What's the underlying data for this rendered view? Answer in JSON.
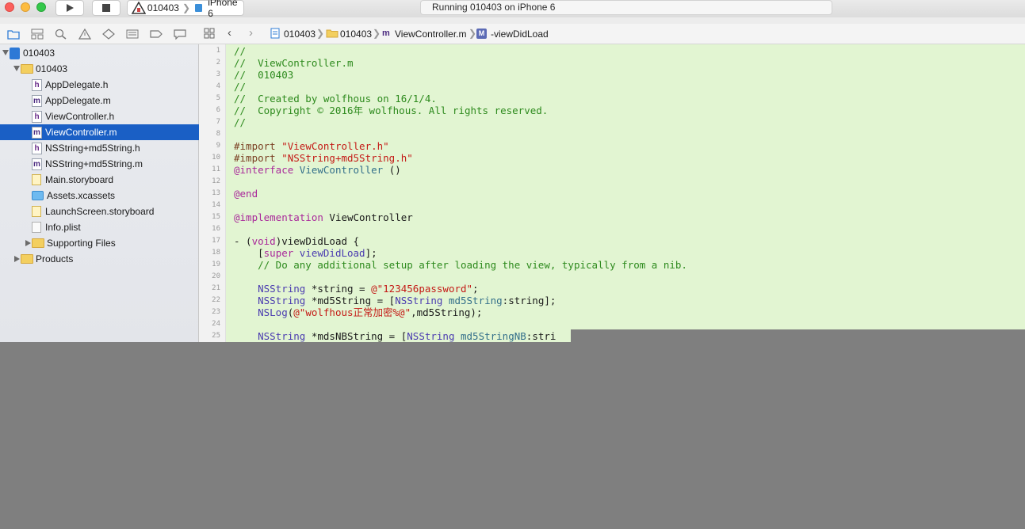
{
  "toolbar": {
    "scheme_name": "010403",
    "device_name": "iPhone 6",
    "activity_text": "Running 010403 on iPhone 6"
  },
  "navigator": {
    "icons": [
      "folder-icon",
      "hierarchy-icon",
      "search-icon",
      "warning-icon",
      "test-icon",
      "debug-icon",
      "breakpoint-icon",
      "report-icon"
    ],
    "tree": [
      {
        "label": "010403",
        "kind": "project",
        "indent": 0,
        "disclosure": "down"
      },
      {
        "label": "010403",
        "kind": "folder",
        "indent": 1,
        "disclosure": "down"
      },
      {
        "label": "AppDelegate.h",
        "kind": "h",
        "indent": 2
      },
      {
        "label": "AppDelegate.m",
        "kind": "m",
        "indent": 2
      },
      {
        "label": "ViewController.h",
        "kind": "h",
        "indent": 2
      },
      {
        "label": "ViewController.m",
        "kind": "m",
        "indent": 2,
        "selected": true
      },
      {
        "label": "NSString+md5String.h",
        "kind": "h",
        "indent": 2
      },
      {
        "label": "NSString+md5String.m",
        "kind": "m",
        "indent": 2
      },
      {
        "label": "Main.storyboard",
        "kind": "storyboard",
        "indent": 2
      },
      {
        "label": "Assets.xcassets",
        "kind": "assets",
        "indent": 2
      },
      {
        "label": "LaunchScreen.storyboard",
        "kind": "storyboard",
        "indent": 2
      },
      {
        "label": "Info.plist",
        "kind": "plist",
        "indent": 2
      },
      {
        "label": "Supporting Files",
        "kind": "folder",
        "indent": 2,
        "disclosure": "right"
      },
      {
        "label": "Products",
        "kind": "folder",
        "indent": 1,
        "disclosure": "right"
      }
    ]
  },
  "jumpbar": {
    "project": "010403",
    "group": "010403",
    "file": "ViewController.m",
    "method": "-viewDidLoad"
  },
  "editor": {
    "lines": [
      {
        "n": "1",
        "parts": [
          [
            "c-comment",
            "//"
          ]
        ]
      },
      {
        "n": "2",
        "parts": [
          [
            "c-comment",
            "//  ViewController.m"
          ]
        ]
      },
      {
        "n": "3",
        "parts": [
          [
            "c-comment",
            "//  010403"
          ]
        ]
      },
      {
        "n": "4",
        "parts": [
          [
            "c-comment",
            "//"
          ]
        ]
      },
      {
        "n": "5",
        "parts": [
          [
            "c-comment",
            "//  Created by wolfhous on 16/1/4."
          ]
        ]
      },
      {
        "n": "6",
        "parts": [
          [
            "c-comment",
            "//  Copyright © 2016年 wolfhous. All rights reserved."
          ]
        ]
      },
      {
        "n": "7",
        "parts": [
          [
            "c-comment",
            "//"
          ]
        ]
      },
      {
        "n": "8",
        "parts": []
      },
      {
        "n": "9",
        "parts": [
          [
            "c-pre",
            "#import "
          ],
          [
            "c-str",
            "\"ViewController.h\""
          ]
        ]
      },
      {
        "n": "10",
        "parts": [
          [
            "c-pre",
            "#import "
          ],
          [
            "c-str",
            "\"NSString+md5String.h\""
          ]
        ]
      },
      {
        "n": "11",
        "parts": [
          [
            "c-kw",
            "@interface "
          ],
          [
            "c-teal",
            "ViewController "
          ],
          [
            "c-plain",
            "()"
          ]
        ]
      },
      {
        "n": "12",
        "parts": []
      },
      {
        "n": "13",
        "parts": [
          [
            "c-kw",
            "@end"
          ]
        ]
      },
      {
        "n": "14",
        "parts": []
      },
      {
        "n": "15",
        "parts": [
          [
            "c-kw",
            "@implementation "
          ],
          [
            "c-plain",
            "ViewController"
          ]
        ]
      },
      {
        "n": "16",
        "parts": []
      },
      {
        "n": "17",
        "parts": [
          [
            "c-plain",
            "- ("
          ],
          [
            "c-kw",
            "void"
          ],
          [
            "c-plain",
            ")viewDidLoad {"
          ]
        ]
      },
      {
        "n": "18",
        "parts": [
          [
            "c-plain",
            "    ["
          ],
          [
            "c-kw",
            "super "
          ],
          [
            "c-cls",
            "viewDidLoad"
          ],
          [
            "c-plain",
            "];"
          ]
        ]
      },
      {
        "n": "19",
        "parts": [
          [
            "c-comment",
            "    // Do any additional setup after loading the view, typically from a nib."
          ]
        ]
      },
      {
        "n": "20",
        "parts": []
      },
      {
        "n": "21",
        "parts": [
          [
            "c-cls",
            "    NSString "
          ],
          [
            "c-plain",
            "*string = "
          ],
          [
            "c-str",
            "@\"123456password\""
          ],
          [
            "c-plain",
            ";"
          ]
        ]
      },
      {
        "n": "22",
        "parts": [
          [
            "c-cls",
            "    NSString "
          ],
          [
            "c-plain",
            "*md5String = ["
          ],
          [
            "c-cls",
            "NSString "
          ],
          [
            "c-teal",
            "md5String"
          ],
          [
            "c-plain",
            ":string];"
          ]
        ]
      },
      {
        "n": "23",
        "parts": [
          [
            "c-cls",
            "    NSLog"
          ],
          [
            "c-plain",
            "("
          ],
          [
            "c-str",
            "@\"wolfhous正常加密%@\""
          ],
          [
            "c-plain",
            ",md5String);"
          ]
        ]
      },
      {
        "n": "24",
        "parts": []
      },
      {
        "n": "25",
        "parts": [
          [
            "c-cls",
            "    NSString "
          ],
          [
            "c-plain",
            "*mdsNBString = ["
          ],
          [
            "c-cls",
            "NSString "
          ],
          [
            "c-teal",
            "md5StringNB"
          ],
          [
            "c-plain",
            ":stri"
          ]
        ]
      }
    ]
  }
}
